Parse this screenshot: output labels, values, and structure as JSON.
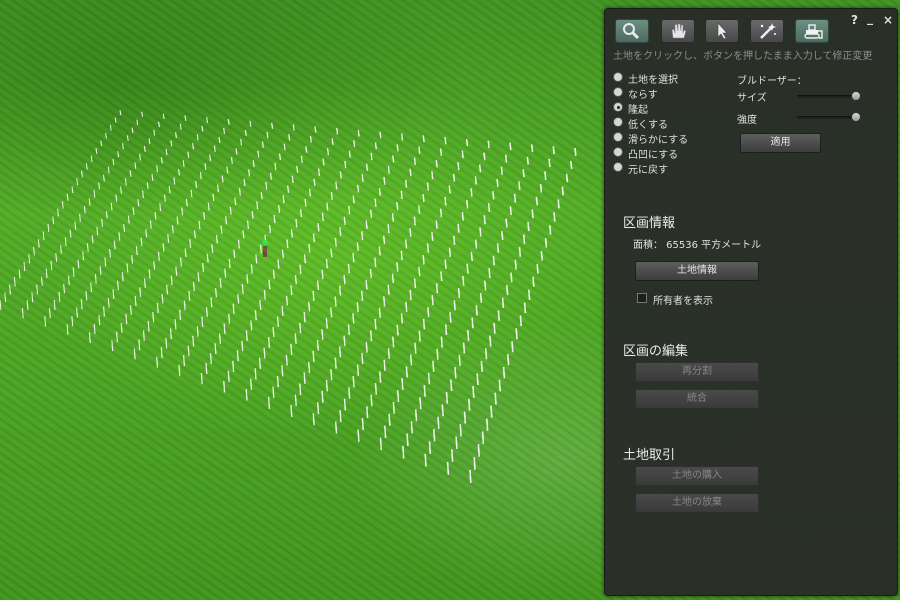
{
  "panel": {
    "controls": {
      "help": "?",
      "minimize": "_",
      "close": "×"
    },
    "tools": [
      {
        "icon": "magnifier-icon",
        "selected": true
      },
      {
        "icon": "hand-icon",
        "selected": false
      },
      {
        "icon": "arrow-pointer-icon",
        "selected": false
      },
      {
        "icon": "magic-wand-icon",
        "selected": false
      },
      {
        "icon": "bulldozer-icon",
        "selected": true
      }
    ],
    "hint": "土地をクリックし、ボタンを押したまま入力して修正変更",
    "modes": [
      {
        "label": "土地を選択",
        "checked": false
      },
      {
        "label": "ならす",
        "checked": false
      },
      {
        "label": "隆起",
        "checked": true
      },
      {
        "label": "低くする",
        "checked": false
      },
      {
        "label": "滑らかにする",
        "checked": false
      },
      {
        "label": "凸凹にする",
        "checked": false
      },
      {
        "label": "元に戻す",
        "checked": false
      }
    ],
    "bulldozer": {
      "label": "ブルドーザー：",
      "size_label": "サイズ",
      "size_value": 0.9,
      "strength_label": "強度",
      "strength_value": 0.9,
      "apply_label": "適用"
    },
    "parcel_info": {
      "heading": "区画情報",
      "area": "面積： 65536 平方メートル",
      "about_land_label": "土地情報",
      "show_owners_label": "所有者を表示",
      "show_owners_checked": false
    },
    "parcel_edit": {
      "heading": "区画の編集",
      "subdivide_label": "再分割",
      "join_label": "統合"
    },
    "land_sale": {
      "heading": "土地取引",
      "buy_label": "土地の購入",
      "abandon_label": "土地の放棄"
    }
  },
  "colors": {
    "panel_bg": "#2a2c2a",
    "selected_tool": "#5c7f74",
    "grass": "#4aa321"
  }
}
